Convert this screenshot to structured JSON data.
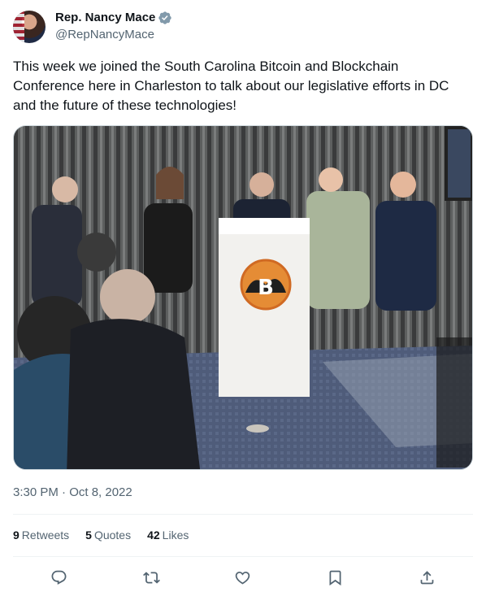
{
  "author": {
    "display_name": "Rep. Nancy Mace",
    "handle": "@RepNancyMace",
    "verified_badge": "gray-check-badge",
    "verified_color": "#829aab"
  },
  "tweet": {
    "text": "This week we joined the South Carolina Bitcoin and Blockchain Conference here in Charleston to talk about our legislative efforts in DC and the future of these technologies!",
    "timestamp": "3:30 PM · Oct 8, 2022"
  },
  "media": {
    "podium_logo_letter": "B"
  },
  "stats": [
    {
      "count": "9",
      "label": "Retweets"
    },
    {
      "count": "5",
      "label": "Quotes"
    },
    {
      "count": "42",
      "label": "Likes"
    }
  ],
  "actions": [
    {
      "name": "reply-icon"
    },
    {
      "name": "retweet-icon"
    },
    {
      "name": "like-icon"
    },
    {
      "name": "bookmark-icon"
    },
    {
      "name": "share-icon"
    }
  ],
  "colors": {
    "text": "#0f1419",
    "secondary": "#536471",
    "divider": "#eff3f4",
    "icon": "#536471"
  }
}
